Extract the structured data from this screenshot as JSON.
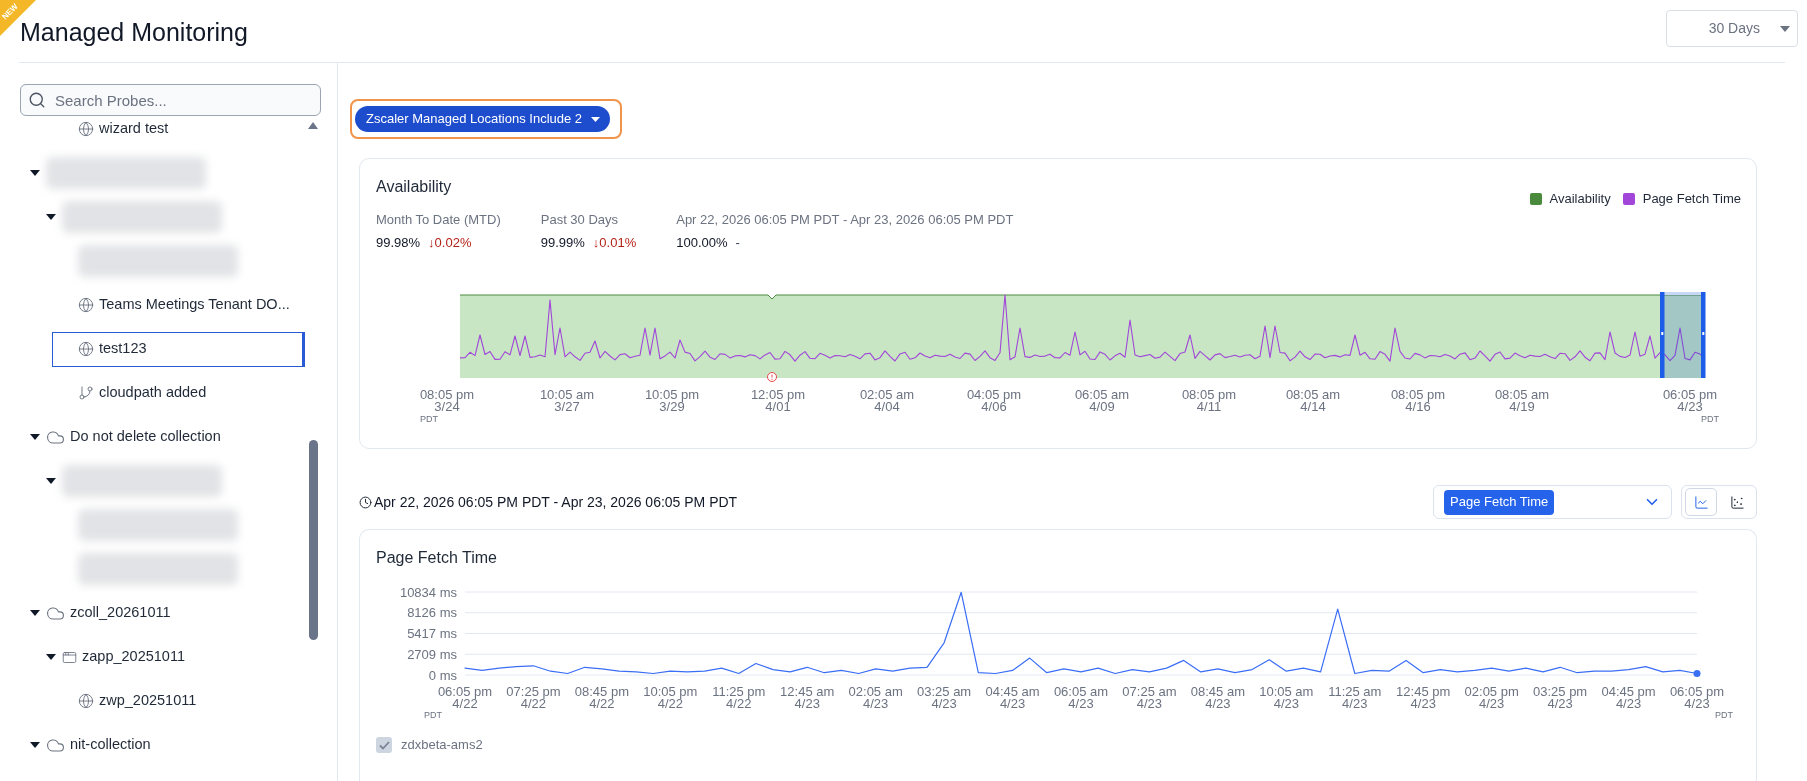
{
  "header": {
    "badge": "NEW",
    "title": "Managed Monitoring",
    "range_select": {
      "value": "30 Days"
    }
  },
  "sidebar": {
    "search": {
      "placeholder": "Search Probes..."
    },
    "tree": [
      {
        "kind": "offscreen",
        "children": [
          {
            "kind": "offscreen",
            "children": [
              {
                "kind": "probe",
                "label": "wizard test",
                "selected": false
              }
            ]
          }
        ]
      },
      {
        "kind": "collection",
        "redacted": true,
        "expanded": true,
        "selected": false,
        "children": [
          {
            "kind": "application",
            "redacted": true,
            "expanded": true,
            "selected": false,
            "children": [
              {
                "kind": "probe",
                "redacted": true,
                "selected": false
              },
              {
                "kind": "probe",
                "label": "Teams Meetings Tenant DO...",
                "selected": false
              },
              {
                "kind": "probe",
                "label": "test123",
                "selected": true
              },
              {
                "kind": "cloudpath",
                "label": "cloudpath added",
                "selected": false
              }
            ]
          }
        ]
      },
      {
        "kind": "collection",
        "label": "Do not delete collection",
        "expanded": true,
        "selected": false,
        "children": [
          {
            "kind": "application",
            "redacted": true,
            "expanded": true,
            "selected": false,
            "children": [
              {
                "kind": "probe",
                "redacted": true,
                "selected": false
              },
              {
                "kind": "cloudpath",
                "redacted": true,
                "selected": false
              }
            ]
          }
        ]
      },
      {
        "kind": "collection",
        "label": "zcoll_20261011",
        "expanded": true,
        "selected": false,
        "children": [
          {
            "kind": "application",
            "label": "zapp_20251011",
            "expanded": true,
            "selected": false,
            "children": [
              {
                "kind": "probe",
                "label": "zwp_20251011",
                "selected": false
              }
            ]
          }
        ]
      },
      {
        "kind": "collection",
        "label": "nit-collection",
        "expanded": true,
        "selected": false
      }
    ]
  },
  "filter_chip": {
    "label": "Zscaler Managed Locations Include 2",
    "focused": true
  },
  "availability_card": {
    "title": "Availability",
    "legend": [
      {
        "label": "Availability",
        "color": "#4a8a3c"
      },
      {
        "label": "Page Fetch Time",
        "color": "#a146d9"
      }
    ],
    "stats": [
      {
        "label": "Month To Date (MTD)",
        "value": "99.98%",
        "change": "↓0.02%",
        "color": "#b42318"
      },
      {
        "label": "Past 30 Days",
        "value": "99.99%",
        "change": "↓0.01%",
        "color": "#b42318"
      },
      {
        "label": "Apr 22, 2026 06:05 PM PDT - Apr 23, 2026 06:05 PM PDT",
        "value": "100.00%",
        "change": "-"
      }
    ],
    "x_labels": [
      "08:05 pm\n3/24",
      "10:05 am\n3/27",
      "10:05 pm\n3/29",
      "12:05 pm\n4/01",
      "02:05 am\n4/04",
      "04:05 pm\n4/06",
      "06:05 am\n4/09",
      "08:05 pm\n4/11",
      "08:05 am\n4/14",
      "08:05 pm\n4/16",
      "08:05 am\n4/19",
      "06:05 pm\n4/23"
    ],
    "timezone_labels": [
      "PDT",
      "PDT"
    ]
  },
  "detail_toolbar": {
    "range_label": "Apr 22, 2026 06:05 PM PDT - Apr 23, 2026 06:05 PM PDT",
    "metric_select": {
      "value": "Page Fetch Time"
    },
    "views": [
      {
        "kind": "line",
        "selected": true
      },
      {
        "kind": "scatter",
        "selected": false
      }
    ]
  },
  "page_fetch_card": {
    "timezone_labels": [
      "PDT",
      "PDT"
    ],
    "series_toggles": [
      {
        "checked": true
      }
    ],
    "chart_data": {
      "type": "line",
      "title": "Page Fetch Time",
      "grid": true,
      "categories": [
        "06:05 pm\n4/22",
        null,
        null,
        null,
        "07:25 pm\n4/22",
        null,
        null,
        null,
        "08:45 pm\n4/22",
        null,
        null,
        null,
        "10:05 pm\n4/22",
        null,
        null,
        null,
        "11:25 pm\n4/22",
        null,
        null,
        null,
        "12:45 am\n4/23",
        null,
        null,
        null,
        "02:05 am\n4/23",
        null,
        null,
        null,
        "03:25 am\n4/23",
        null,
        null,
        null,
        "04:45 am\n4/23",
        null,
        null,
        null,
        "06:05 am\n4/23",
        null,
        null,
        null,
        "07:25 am\n4/23",
        null,
        null,
        null,
        "08:45 am\n4/23",
        null,
        null,
        null,
        "10:05 am\n4/23",
        null,
        null,
        null,
        "11:25 am\n4/23",
        null,
        null,
        null,
        "12:45 pm\n4/23",
        null,
        null,
        null,
        "02:05 pm\n4/23",
        null,
        null,
        null,
        "03:25 pm\n4/23",
        null,
        null,
        null,
        "04:45 pm\n4/23",
        null,
        null,
        null,
        "06:05 pm\n4/23"
      ],
      "series": [
        {
          "name": "zdxbeta-ams2",
          "color": "#3b6ef6",
          "values": [
            900,
            600,
            900,
            1100,
            1200,
            500,
            200,
            1000,
            800,
            500,
            400,
            200,
            500,
            400,
            500,
            900,
            200,
            1500,
            700,
            400,
            1000,
            300,
            600,
            200,
            800,
            500,
            900,
            1000,
            4200,
            10800,
            300,
            200,
            600,
            2200,
            300,
            800,
            400,
            900,
            200,
            700,
            400,
            900,
            1900,
            400,
            800,
            300,
            700,
            2000,
            500,
            900,
            400,
            8600,
            200,
            600,
            500,
            1900,
            300,
            700,
            400,
            600,
            900,
            500,
            900,
            400,
            1000,
            300,
            500,
            500,
            700,
            1100,
            400,
            600,
            200
          ]
        }
      ],
      "ylim": [
        0,
        10834
      ],
      "yticks": [
        {
          "value": 0,
          "label": "0 ms"
        },
        {
          "value": 2709,
          "label": "2709 ms"
        },
        {
          "value": 5417,
          "label": "5417 ms"
        },
        {
          "value": 8126,
          "label": "8126 ms"
        },
        {
          "value": 10834,
          "label": "10834 ms"
        }
      ]
    }
  }
}
